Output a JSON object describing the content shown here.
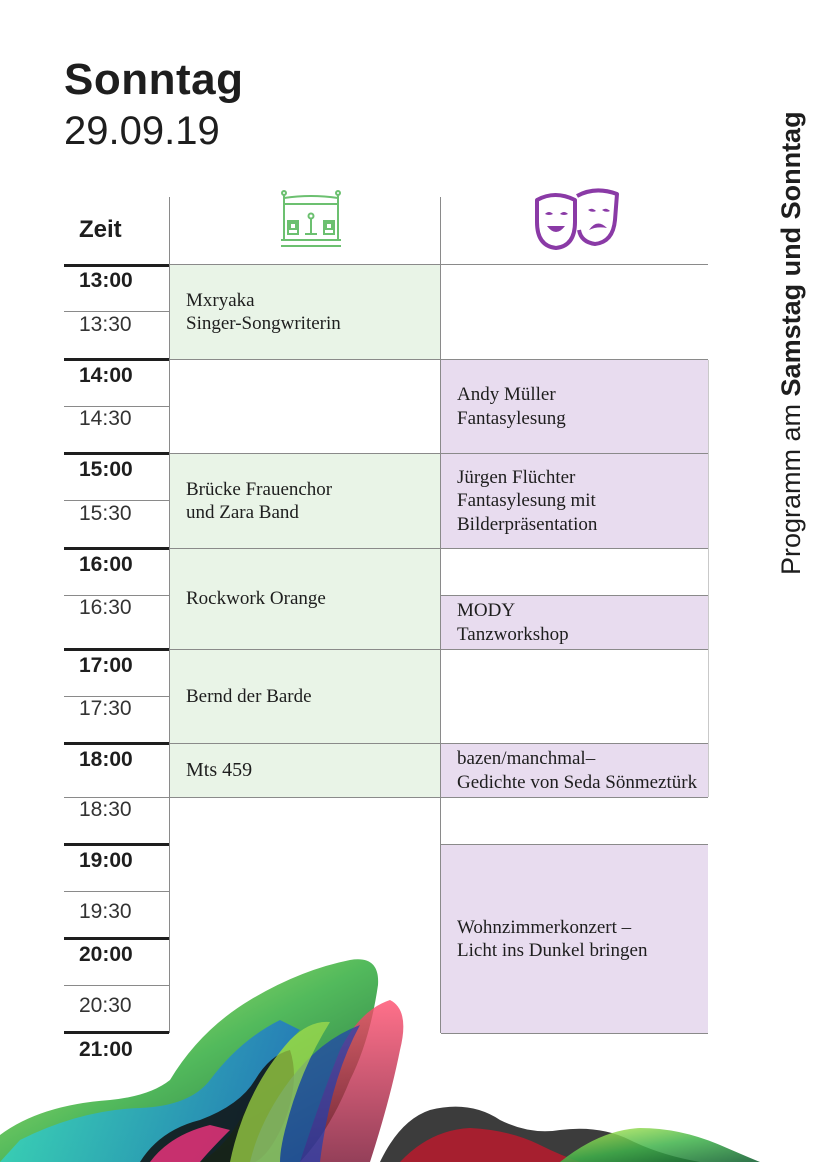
{
  "header": {
    "day": "Sonntag",
    "date": "29.09.19"
  },
  "sidebar": {
    "prefix": "Programm am ",
    "bold": "Samstag und Sonntag"
  },
  "table": {
    "time_header": "Zeit",
    "times": [
      "13:00",
      "13:30",
      "14:00",
      "14:30",
      "15:00",
      "15:30",
      "16:00",
      "16:30",
      "17:00",
      "17:30",
      "18:00",
      "18:30",
      "19:00",
      "19:30",
      "20:00",
      "20:30",
      "21:00"
    ],
    "stage_events": [
      {
        "lines": [
          "Mxryaka",
          "Singer-Songwriterin"
        ]
      },
      {
        "lines": [
          "Brücke Frauenchor",
          "und Zara Band"
        ]
      },
      {
        "lines": [
          "Rockwork Orange"
        ]
      },
      {
        "lines": [
          "Bernd der Barde"
        ]
      },
      {
        "lines": [
          "Mts 459"
        ]
      }
    ],
    "theater_events": [
      {
        "lines": [
          "Andy Müller",
          "Fantasylesung"
        ]
      },
      {
        "lines": [
          "Jürgen Flüchter",
          "Fantasylesung mit",
          "Bilderpräsentation"
        ]
      },
      {
        "lines": [
          "MODY",
          "Tanzworkshop"
        ]
      },
      {
        "lines": [
          "bazen/manchmal–",
          "Gedichte von Seda Sönmeztürk"
        ]
      },
      {
        "lines": [
          "Wohnzimmerkonzert –",
          "Licht ins Dunkel bringen"
        ]
      }
    ]
  },
  "icons": {
    "stage": "stage-icon",
    "theater": "theater-masks-icon"
  },
  "colors": {
    "stage_bg": "#e9f4e7",
    "theater_bg": "#e8dcef",
    "stage_icon": "#6cc070",
    "theater_icon": "#8a3aa6"
  }
}
